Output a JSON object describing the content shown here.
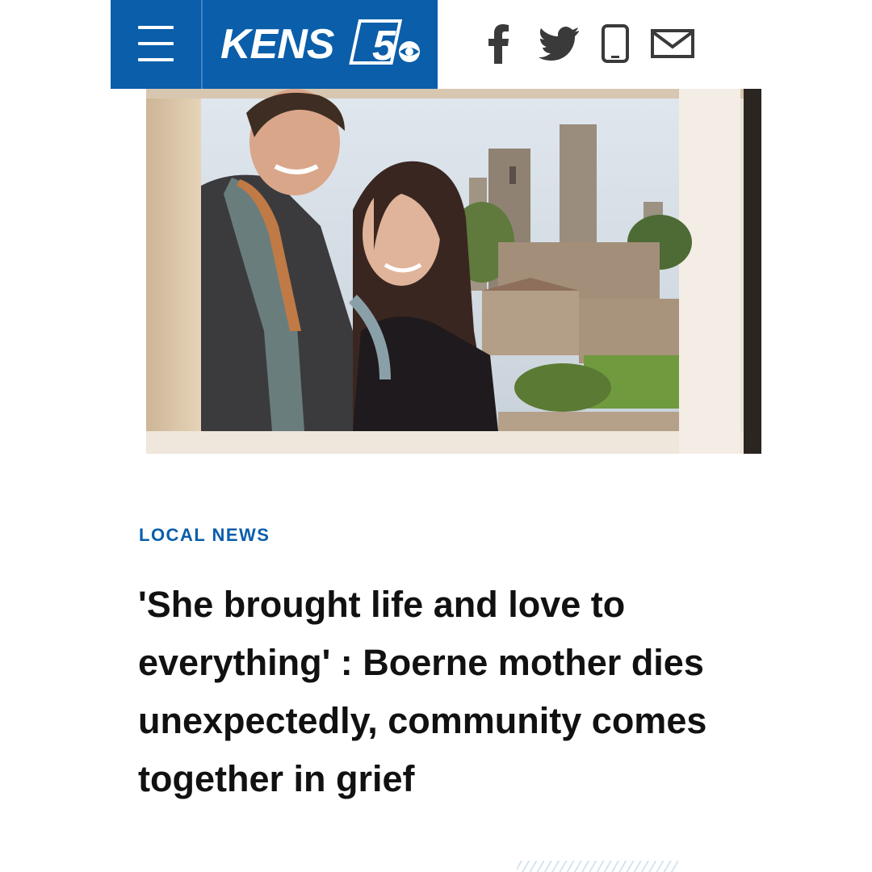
{
  "header": {
    "brand_name": "KENS",
    "brand_number": "5",
    "menu_icon": "hamburger-menu-icon",
    "brand_color": "#0a5eaa",
    "social": [
      {
        "icon": "facebook-icon"
      },
      {
        "icon": "twitter-icon"
      },
      {
        "icon": "phone-icon"
      },
      {
        "icon": "email-icon"
      }
    ]
  },
  "article": {
    "section": "LOCAL NEWS",
    "headline": "'She brought life and love to everything' : Boerne mother dies unexpectedly, community comes together in grief"
  },
  "colors": {
    "accent": "#0a5eaa",
    "text": "#111111"
  }
}
